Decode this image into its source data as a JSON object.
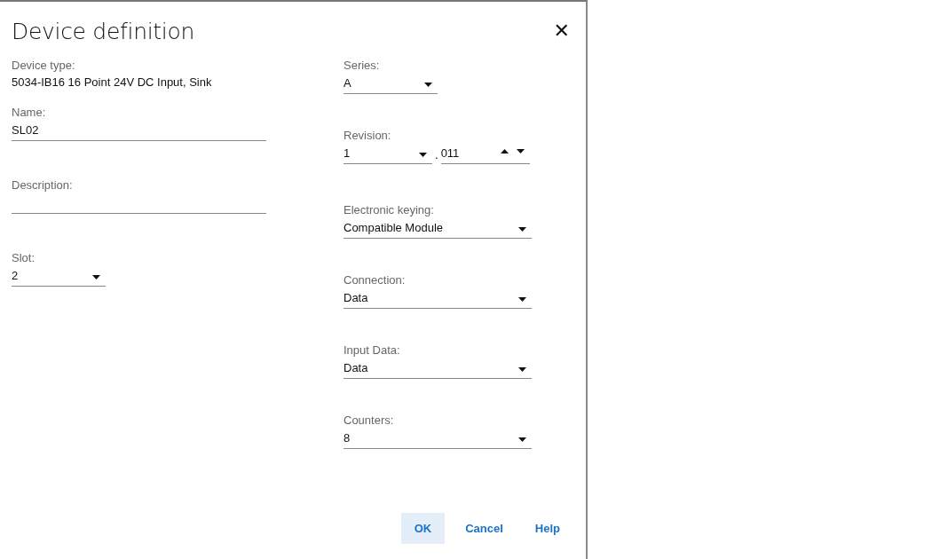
{
  "dialog": {
    "title": "Device definition",
    "close": "✕"
  },
  "left_fields": [
    {
      "kind": "static",
      "label": "Device type:",
      "value": "5034-IB16 16 Point 24V DC Input, Sink"
    },
    {
      "kind": "text",
      "label": "Name:",
      "value": "SL02"
    },
    {
      "kind": "text",
      "label": "Description:"
    },
    {
      "kind": "dropdown",
      "label": "Slot:",
      "value": "2"
    }
  ],
  "right_fields": [
    {
      "kind": "dropdown",
      "label": "Series:",
      "value": "A"
    },
    {
      "kind": "revision",
      "label": "Revision:",
      "major": "1",
      "separator": ".",
      "minor": "011"
    },
    {
      "kind": "dropdown",
      "label": "Electronic keying:",
      "value": "Compatible Module"
    },
    {
      "kind": "dropdown",
      "label": "Connection:",
      "value": "Data"
    },
    {
      "kind": "dropdown",
      "label": "Input Data:",
      "value": "Data"
    },
    {
      "kind": "dropdown",
      "label": "Counters:",
      "value": "8"
    }
  ],
  "buttons": [
    {
      "label": "OK",
      "kind": "primary"
    },
    {
      "label": "Cancel",
      "kind": "plain"
    },
    {
      "label": "Help",
      "kind": "plain"
    }
  ]
}
